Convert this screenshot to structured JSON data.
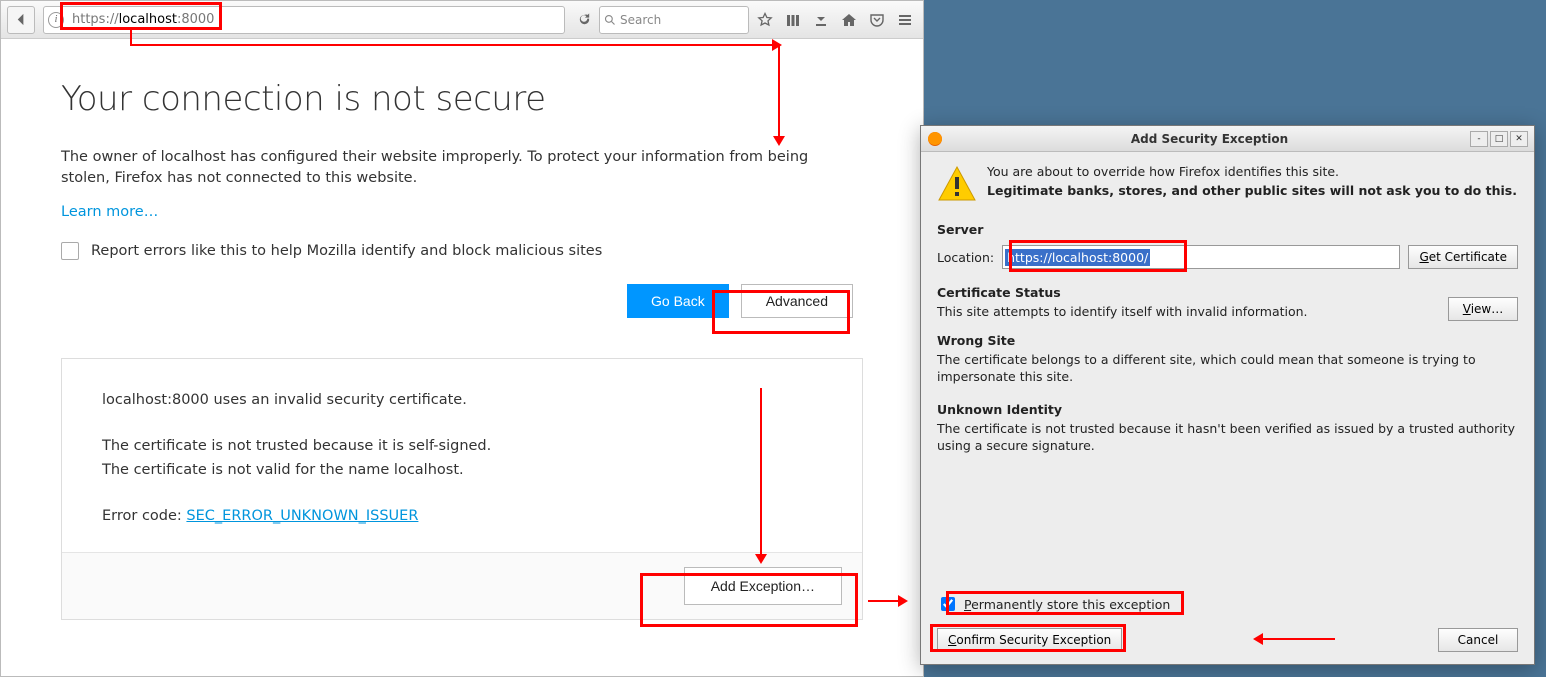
{
  "url": "https://localhost:8000",
  "search_placeholder": "Search",
  "page": {
    "heading": "Your connection is not secure",
    "desc": "The owner of localhost has configured their website improperly. To protect your information from being stolen, Firefox has not connected to this website.",
    "learn_more": "Learn more…",
    "report_label": "Report errors like this to help Mozilla identify and block malicious sites",
    "go_back": "Go Back",
    "advanced": "Advanced",
    "adv_line1": "localhost:8000 uses an invalid security certificate.",
    "adv_line2": "The certificate is not trusted because it is self-signed.",
    "adv_line3": "The certificate is not valid for the name localhost.",
    "error_label": "Error code: ",
    "error_code": "SEC_ERROR_UNKNOWN_ISSUER",
    "add_exception": "Add Exception…"
  },
  "dialog": {
    "title": "Add Security Exception",
    "warn1": "You are about to override how Firefox identifies this site.",
    "warn2": "Legitimate banks, stores, and other public sites will not ask you to do this.",
    "server_h": "Server",
    "location_label": "Location:",
    "location_value": "https://localhost:8000/",
    "get_cert": "Get Certificate",
    "cert_status_h": "Certificate Status",
    "cert_status_p": "This site attempts to identify itself with invalid information.",
    "view": "View…",
    "wrong_site_h": "Wrong Site",
    "wrong_site_p": "The certificate belongs to a different site, which could mean that someone is trying to impersonate this site.",
    "unknown_h": "Unknown Identity",
    "unknown_p": "The certificate is not trusted because it hasn't been verified as issued by a trusted authority using a secure signature.",
    "perm_label": "Permanently store this exception",
    "confirm": "Confirm Security Exception",
    "cancel": "Cancel"
  }
}
